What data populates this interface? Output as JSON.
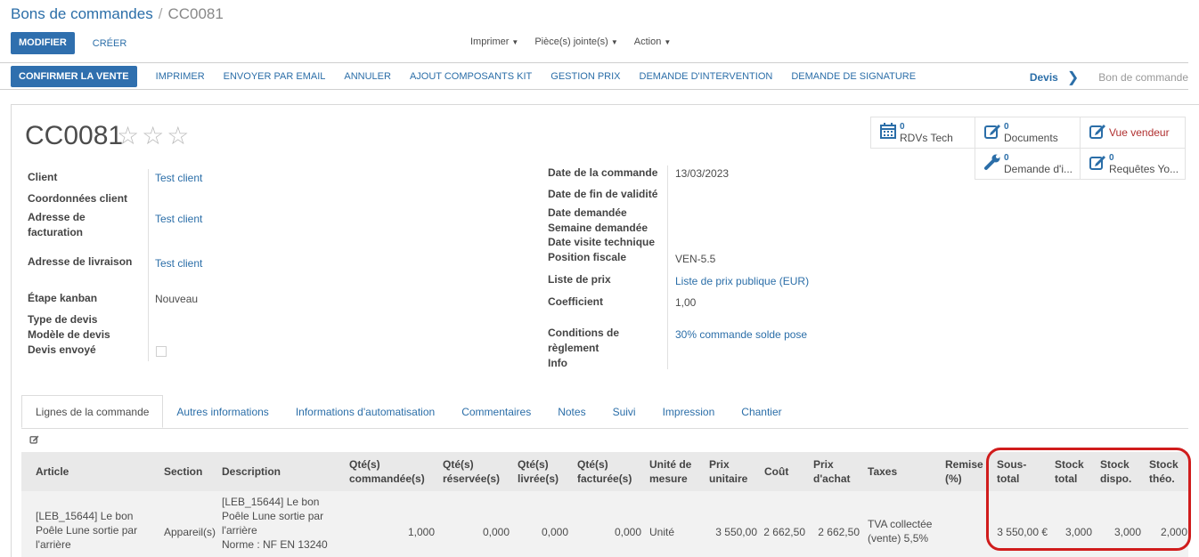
{
  "breadcrumb": {
    "parent": "Bons de commandes",
    "separator": "/",
    "current": "CC0081"
  },
  "actions": {
    "edit": "MODIFIER",
    "create": "CRÉER"
  },
  "dropdowns": {
    "print": "Imprimer",
    "attachments": "Pièce(s) jointe(s)",
    "action": "Action"
  },
  "statusbar": {
    "buttons": [
      "CONFIRMER LA VENTE",
      "IMPRIMER",
      "ENVOYER PAR EMAIL",
      "ANNULER",
      "AJOUT COMPOSANTS KIT",
      "GESTION PRIX",
      "DEMANDE D'INTERVENTION",
      "DEMANDE DE SIGNATURE"
    ],
    "stage_active": "Devis",
    "stage_next": "Bon de commande"
  },
  "record": {
    "name": "CC0081",
    "stars": "☆☆☆"
  },
  "smart_buttons": {
    "rdv": {
      "count": "0",
      "label": "RDVs Tech"
    },
    "documents": {
      "count": "0",
      "label": "Documents"
    },
    "vendor": {
      "label": "Vue vendeur"
    },
    "intervention": {
      "count": "0",
      "label": "Demande d'i..."
    },
    "requests": {
      "count": "0",
      "label": "Requêtes Yo..."
    }
  },
  "left_fields": {
    "client_label": "Client",
    "client_value": "Test client",
    "coord_label": "Coordonnées client",
    "billing_label_1": "Adresse de",
    "billing_label_2": "facturation",
    "billing_value": "Test client",
    "delivery_label": "Adresse de livraison",
    "delivery_value": "Test client",
    "kanban_label": "Étape kanban",
    "kanban_value": "Nouveau",
    "quote_type_label": "Type de devis",
    "quote_model_label": "Modèle de devis",
    "quote_sent_label": "Devis envoyé"
  },
  "right_fields": {
    "order_date_label": "Date de la commande",
    "order_date_value": "13/03/2023",
    "validity_label": "Date de fin de validité",
    "requested_date_label": "Date demandée",
    "requested_week_label": "Semaine demandée",
    "visit_date_label": "Date visite technique",
    "fiscal_label": "Position fiscale",
    "fiscal_value": "VEN-5.5",
    "pricelist_label": "Liste de prix",
    "pricelist_value": "Liste de prix publique (EUR)",
    "coef_label": "Coefficient",
    "coef_value": "1,00",
    "terms_label_1": "Conditions de",
    "terms_label_2": "règlement",
    "terms_value": "30% commande solde pose",
    "info_label": "Info"
  },
  "tabs": [
    "Lignes de la commande",
    "Autres informations",
    "Informations d'automatisation",
    "Commentaires",
    "Notes",
    "Suivi",
    "Impression",
    "Chantier"
  ],
  "table": {
    "headers": {
      "article": "Article",
      "section": "Section",
      "description": "Description",
      "qty_ordered_1": "Qté(s)",
      "qty_ordered_2": "commandée(s)",
      "qty_reserved_1": "Qté(s)",
      "qty_reserved_2": "réservée(s)",
      "qty_delivered_1": "Qté(s)",
      "qty_delivered_2": "livrée(s)",
      "qty_invoiced_1": "Qté(s)",
      "qty_invoiced_2": "facturée(s)",
      "uom_1": "Unité de",
      "uom_2": "mesure",
      "price_1": "Prix",
      "price_2": "unitaire",
      "cost": "Coût",
      "purchase_1": "Prix",
      "purchase_2": "d'achat",
      "taxes": "Taxes",
      "discount_1": "Remise",
      "discount_2": "(%)",
      "subtotal_1": "Sous-",
      "subtotal_2": "total",
      "stock_total_1": "Stock",
      "stock_total_2": "total",
      "stock_avail_1": "Stock",
      "stock_avail_2": "dispo.",
      "stock_theo_1": "Stock",
      "stock_theo_2": "théo."
    },
    "row": {
      "article_1": "[LEB_15644] Le bon",
      "article_2": "Poêle Lune sortie par",
      "article_3": "l'arrière",
      "section": "Appareil(s)",
      "desc_1": "[LEB_15644] Le bon",
      "desc_2": "Poêle Lune sortie par",
      "desc_3": "l'arrière",
      "desc_4": "Norme : NF EN 13240",
      "qty_ordered": "1,000",
      "qty_reserved": "0,000",
      "qty_delivered": "0,000",
      "qty_invoiced": "0,000",
      "uom": "Unité",
      "price": "3 550,00",
      "cost": "2 662,50",
      "purchase": "2 662,50",
      "taxes_1": "TVA collectée",
      "taxes_2": "(vente) 5,5%",
      "subtotal": "3 550,00 €",
      "stock_total": "3,000",
      "stock_avail": "3,000",
      "stock_theo": "2,000"
    }
  }
}
